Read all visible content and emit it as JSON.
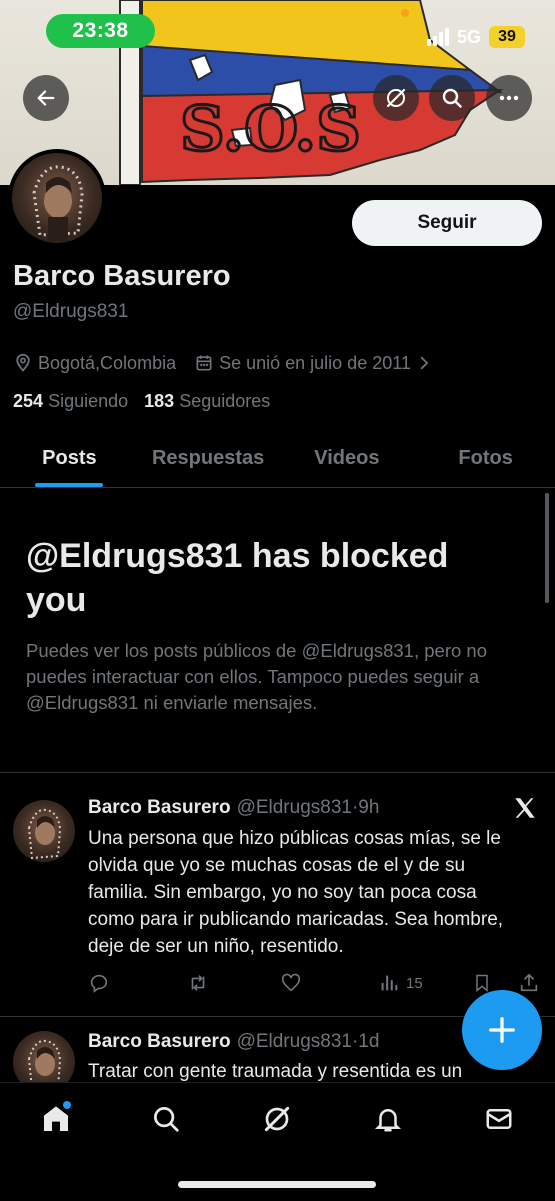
{
  "status_bar": {
    "time": "23:38",
    "network": "5G",
    "battery": "39"
  },
  "profile": {
    "follow_button": "Seguir",
    "display_name": "Barco Basurero",
    "handle": "@Eldrugs831",
    "location": "Bogotá,Colombia",
    "joined": "Se unió en julio de 2011",
    "following_count": "254",
    "following_label": "Siguiendo",
    "followers_count": "183",
    "followers_label": "Seguidores",
    "banner_text": "S.O.S"
  },
  "tabs": [
    {
      "label": "Posts",
      "active": true
    },
    {
      "label": "Respuestas",
      "active": false
    },
    {
      "label": "Videos",
      "active": false
    },
    {
      "label": "Fotos",
      "active": false
    }
  ],
  "blocked_notice": {
    "title": "@Eldrugs831 has blocked you",
    "body": "Puedes ver los posts públicos de @Eldrugs831, pero no puedes interactuar con ellos. Tampoco puedes seguir a @Eldrugs831 ni enviarle mensajes."
  },
  "posts": [
    {
      "name": "Barco Basurero",
      "handle": "@Eldrugs831",
      "time": "·9h",
      "text": "Una persona que hizo públicas cosas mías, se le olvida que yo se muchas cosas de el y de su familia. Sin embargo, yo no soy tan poca cosa como para ir publicando maricadas. Sea hombre, deje de ser un niño, resentido.",
      "views": "15"
    },
    {
      "name": "Barco Basurero",
      "handle": "@Eldrugs831",
      "time": "·1d",
      "text": "Tratar con gente traumada y resentida es un"
    }
  ],
  "icons": {
    "back": "arrow-left-icon",
    "grok": "grok-icon",
    "search": "search-icon",
    "more": "more-icon",
    "location": "location-pin-icon",
    "calendar": "calendar-icon",
    "x_logo": "x-logo-icon",
    "compose": "plus-icon"
  },
  "colors": {
    "accent": "#1d9bf0",
    "status_time_bg": "#1fc14a",
    "battery_bg": "#f4d02a",
    "text_primary": "#e7e9ea",
    "text_secondary": "#71767b"
  }
}
